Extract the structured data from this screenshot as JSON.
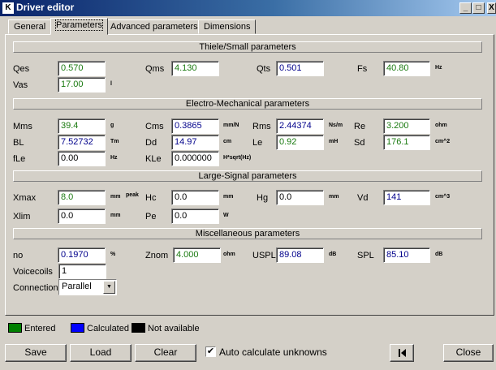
{
  "window": {
    "title": "Driver editor",
    "app_icon": "K",
    "minimize": "_",
    "maximize": "□",
    "close": "X"
  },
  "tabs": [
    "General",
    "Parameters",
    "Advanced parameters",
    "Dimensions"
  ],
  "active_tab": "Parameters",
  "sections": {
    "ts": "Thiele/Small parameters",
    "em": "Electro-Mechanical parameters",
    "ls": "Large-Signal parameters",
    "misc": "Miscellaneous parameters"
  },
  "params": {
    "qes": {
      "label": "Qes",
      "value": "0.570",
      "unit": "",
      "status": "entered"
    },
    "qms": {
      "label": "Qms",
      "value": "4.130",
      "unit": "",
      "status": "entered"
    },
    "qts": {
      "label": "Qts",
      "value": "0.501",
      "unit": "",
      "status": "calculated"
    },
    "fs": {
      "label": "Fs",
      "value": "40.80",
      "unit": "Hz",
      "status": "entered"
    },
    "vas": {
      "label": "Vas",
      "value": "17.00",
      "unit": "l",
      "status": "entered"
    },
    "mms": {
      "label": "Mms",
      "value": "39.4",
      "unit": "g",
      "status": "entered"
    },
    "cms": {
      "label": "Cms",
      "value": "0.3865",
      "unit": "mm/N",
      "status": "calculated"
    },
    "rms": {
      "label": "Rms",
      "value": "2.44374",
      "unit": "Ns/m",
      "status": "calculated"
    },
    "re": {
      "label": "Re",
      "value": "3.200",
      "unit": "ohm",
      "status": "entered"
    },
    "bl": {
      "label": "BL",
      "value": "7.52732",
      "unit": "Tm",
      "status": "calculated"
    },
    "dd": {
      "label": "Dd",
      "value": "14.97",
      "unit": "cm",
      "status": "calculated"
    },
    "le": {
      "label": "Le",
      "value": "0.92",
      "unit": "mH",
      "status": "entered"
    },
    "sd": {
      "label": "Sd",
      "value": "176.1",
      "unit": "cm^2",
      "status": "entered"
    },
    "fle": {
      "label": "fLe",
      "value": "0.00",
      "unit": "Hz",
      "status": "na"
    },
    "kle": {
      "label": "KLe",
      "value": "0.000000",
      "unit": "H*sqrt(Hz)",
      "status": "na"
    },
    "xmax": {
      "label": "Xmax",
      "value": "8.0",
      "unit": "mm",
      "unit2": "peak",
      "status": "entered"
    },
    "hc": {
      "label": "Hc",
      "value": "0.0",
      "unit": "mm",
      "status": "na"
    },
    "hg": {
      "label": "Hg",
      "value": "0.0",
      "unit": "mm",
      "status": "na"
    },
    "vd": {
      "label": "Vd",
      "value": "141",
      "unit": "cm^3",
      "status": "calculated"
    },
    "xlim": {
      "label": "Xlim",
      "value": "0.0",
      "unit": "mm",
      "status": "na"
    },
    "pe": {
      "label": "Pe",
      "value": "0.0",
      "unit": "W",
      "status": "na"
    },
    "no": {
      "label": "no",
      "value": "0.1970",
      "unit": "%",
      "status": "calculated"
    },
    "znom": {
      "label": "Znom",
      "value": "4.000",
      "unit": "ohm",
      "status": "entered"
    },
    "uspl": {
      "label": "USPL",
      "value": "89.08",
      "unit": "dB",
      "status": "calculated"
    },
    "spl": {
      "label": "SPL",
      "value": "85.10",
      "unit": "dB",
      "status": "calculated"
    },
    "voicecoils": {
      "label": "Voicecoils",
      "value": "1",
      "status": "na"
    }
  },
  "connection": {
    "label": "Connection",
    "value": "Parallel"
  },
  "legend": [
    {
      "label": "Entered",
      "color": "#008000"
    },
    {
      "label": "Calculated",
      "color": "#0000ff"
    },
    {
      "label": "Not available",
      "color": "#000000"
    }
  ],
  "buttons": {
    "save": "Save",
    "load": "Load",
    "clear": "Clear",
    "close": "Close"
  },
  "auto_calc": {
    "label": "Auto calculate unknowns",
    "checked": true
  }
}
